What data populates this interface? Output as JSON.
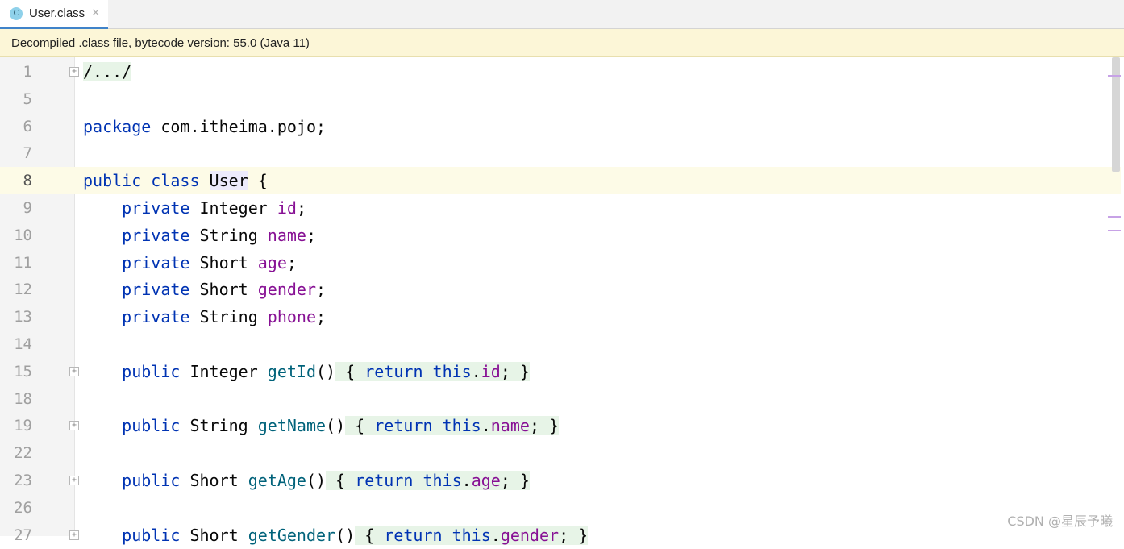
{
  "tab": {
    "icon_letter": "C",
    "icon_name": "class-file-icon",
    "label": "User.class",
    "close": "✕"
  },
  "banner": "Decompiled .class file, bytecode version: 55.0 (Java 11)",
  "lines": [
    {
      "num": "1",
      "fold": true,
      "code": [
        {
          "t": "/.../",
          "c": "folded"
        }
      ]
    },
    {
      "num": "5",
      "code": []
    },
    {
      "num": "6",
      "code": [
        {
          "t": "package",
          "c": "kw"
        },
        {
          "t": " com.itheima.pojo;"
        }
      ]
    },
    {
      "num": "7",
      "code": []
    },
    {
      "num": "8",
      "current": true,
      "code": [
        {
          "t": "public class",
          "c": "kw"
        },
        {
          "t": " "
        },
        {
          "t": "User",
          "c": "hl-class"
        },
        {
          "t": " {"
        }
      ]
    },
    {
      "num": "9",
      "code": [
        {
          "t": "    "
        },
        {
          "t": "private",
          "c": "kw"
        },
        {
          "t": " Integer "
        },
        {
          "t": "id",
          "c": "fld"
        },
        {
          "t": ";"
        }
      ]
    },
    {
      "num": "10",
      "code": [
        {
          "t": "    "
        },
        {
          "t": "private",
          "c": "kw"
        },
        {
          "t": " String "
        },
        {
          "t": "name",
          "c": "fld"
        },
        {
          "t": ";"
        }
      ]
    },
    {
      "num": "11",
      "code": [
        {
          "t": "    "
        },
        {
          "t": "private",
          "c": "kw"
        },
        {
          "t": " Short "
        },
        {
          "t": "age",
          "c": "fld"
        },
        {
          "t": ";"
        }
      ]
    },
    {
      "num": "12",
      "code": [
        {
          "t": "    "
        },
        {
          "t": "private",
          "c": "kw"
        },
        {
          "t": " Short "
        },
        {
          "t": "gender",
          "c": "fld"
        },
        {
          "t": ";"
        }
      ]
    },
    {
      "num": "13",
      "code": [
        {
          "t": "    "
        },
        {
          "t": "private",
          "c": "kw"
        },
        {
          "t": " String "
        },
        {
          "t": "phone",
          "c": "fld"
        },
        {
          "t": ";"
        }
      ]
    },
    {
      "num": "14",
      "code": []
    },
    {
      "num": "15",
      "fold": true,
      "code": [
        {
          "t": "    "
        },
        {
          "t": "public",
          "c": "kw"
        },
        {
          "t": " Integer "
        },
        {
          "t": "getId",
          "c": "mth"
        },
        {
          "t": "()"
        },
        {
          "t": " { ",
          "c": "folded"
        },
        {
          "t": "return this",
          "c": "kw folded"
        },
        {
          "t": ".",
          "c": "folded"
        },
        {
          "t": "id",
          "c": "fld folded"
        },
        {
          "t": "; }",
          "c": "folded"
        }
      ]
    },
    {
      "num": "18",
      "code": []
    },
    {
      "num": "19",
      "fold": true,
      "code": [
        {
          "t": "    "
        },
        {
          "t": "public",
          "c": "kw"
        },
        {
          "t": " String "
        },
        {
          "t": "getName",
          "c": "mth"
        },
        {
          "t": "()"
        },
        {
          "t": " { ",
          "c": "folded"
        },
        {
          "t": "return this",
          "c": "kw folded"
        },
        {
          "t": ".",
          "c": "folded"
        },
        {
          "t": "name",
          "c": "fld folded"
        },
        {
          "t": "; }",
          "c": "folded"
        }
      ]
    },
    {
      "num": "22",
      "code": []
    },
    {
      "num": "23",
      "fold": true,
      "code": [
        {
          "t": "    "
        },
        {
          "t": "public",
          "c": "kw"
        },
        {
          "t": " Short "
        },
        {
          "t": "getAge",
          "c": "mth"
        },
        {
          "t": "()"
        },
        {
          "t": " { ",
          "c": "folded"
        },
        {
          "t": "return this",
          "c": "kw folded"
        },
        {
          "t": ".",
          "c": "folded"
        },
        {
          "t": "age",
          "c": "fld folded"
        },
        {
          "t": "; }",
          "c": "folded"
        }
      ]
    },
    {
      "num": "26",
      "code": []
    },
    {
      "num": "27",
      "fold": true,
      "code": [
        {
          "t": "    "
        },
        {
          "t": "public",
          "c": "kw"
        },
        {
          "t": " Short "
        },
        {
          "t": "getGender",
          "c": "mth"
        },
        {
          "t": "()"
        },
        {
          "t": " { ",
          "c": "folded"
        },
        {
          "t": "return this",
          "c": "kw folded"
        },
        {
          "t": ".",
          "c": "folded"
        },
        {
          "t": "gender",
          "c": "fld folded"
        },
        {
          "t": "; }",
          "c": "folded"
        }
      ]
    }
  ],
  "watermark": "CSDN @星辰予曦",
  "colors": {
    "keyword": "#0033b3",
    "field": "#871094",
    "method": "#00627a",
    "banner_bg": "#fcf6d7",
    "current_line": "#fdfbe7"
  }
}
